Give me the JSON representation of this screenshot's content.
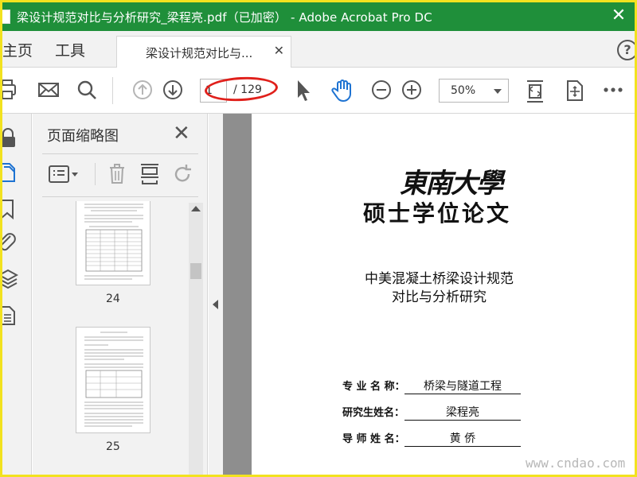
{
  "window": {
    "title": "梁设计规范对比与分析研究_梁程亮.pdf（已加密） - Adobe Acrobat Pro DC",
    "close_glyph": "✕"
  },
  "menu": {
    "home": "主页",
    "tools": "工具",
    "tab_label": "梁设计规范对比与...",
    "tab_close": "✕",
    "help": "?"
  },
  "toolbar": {
    "page_current": "1",
    "page_total": "/ 129",
    "zoom": "50%"
  },
  "thumbnail_pane": {
    "title": "页面缩略图",
    "close_glyph": "✕",
    "pages": [
      "24",
      "25"
    ]
  },
  "document": {
    "university": "東南大學",
    "degree": "硕士学位论文",
    "title_line1": "中美混凝土桥梁设计规范",
    "title_line2": "对比与分析研究",
    "fields": [
      {
        "label": "专 业 名 称：",
        "value": "桥梁与隧道工程"
      },
      {
        "label": "研究生姓名：",
        "value": "梁程亮"
      },
      {
        "label": "导 师 姓 名：",
        "value": "黄  侨"
      }
    ]
  },
  "watermark": "www.cndao.com",
  "colors": {
    "title_bar": "#1f8f3a",
    "annotation": "#e0201b",
    "highlight": "#1e73d2",
    "border": "#f2e21f"
  }
}
